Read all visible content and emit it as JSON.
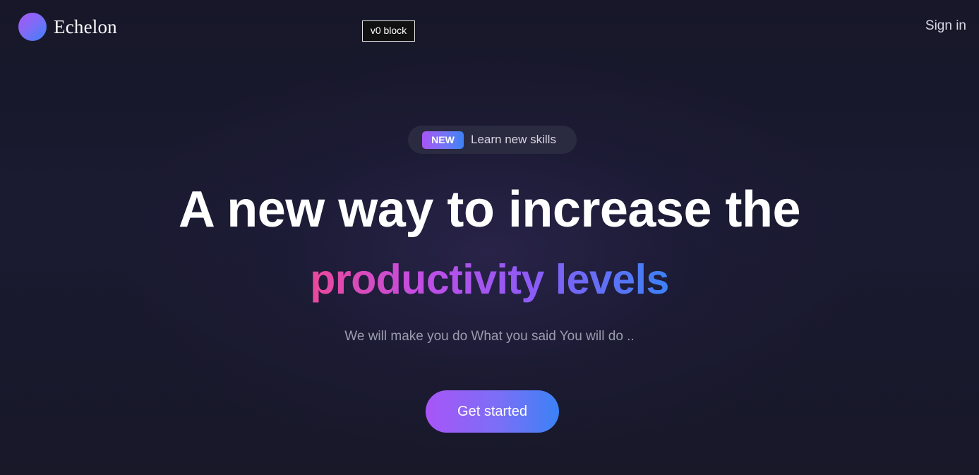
{
  "header": {
    "brand": "Echelon",
    "v0_badge": "v0 block",
    "signin_label": "Sign in"
  },
  "hero": {
    "pill_badge": "NEW",
    "pill_text": "Learn new skills",
    "headline_line1": "A new way to increase the",
    "headline_line2": "productivity levels",
    "subtitle": "We will make you do What you said You will do ..",
    "cta_label": "Get started"
  },
  "icons": {
    "logo": "gradient-circle-logo-icon"
  },
  "colors": {
    "background": "#19192d",
    "accent_start": "#a855f7",
    "accent_end": "#3b82f6",
    "headline_pink": "#ec4899",
    "pill_bg": "#2a2a40"
  }
}
